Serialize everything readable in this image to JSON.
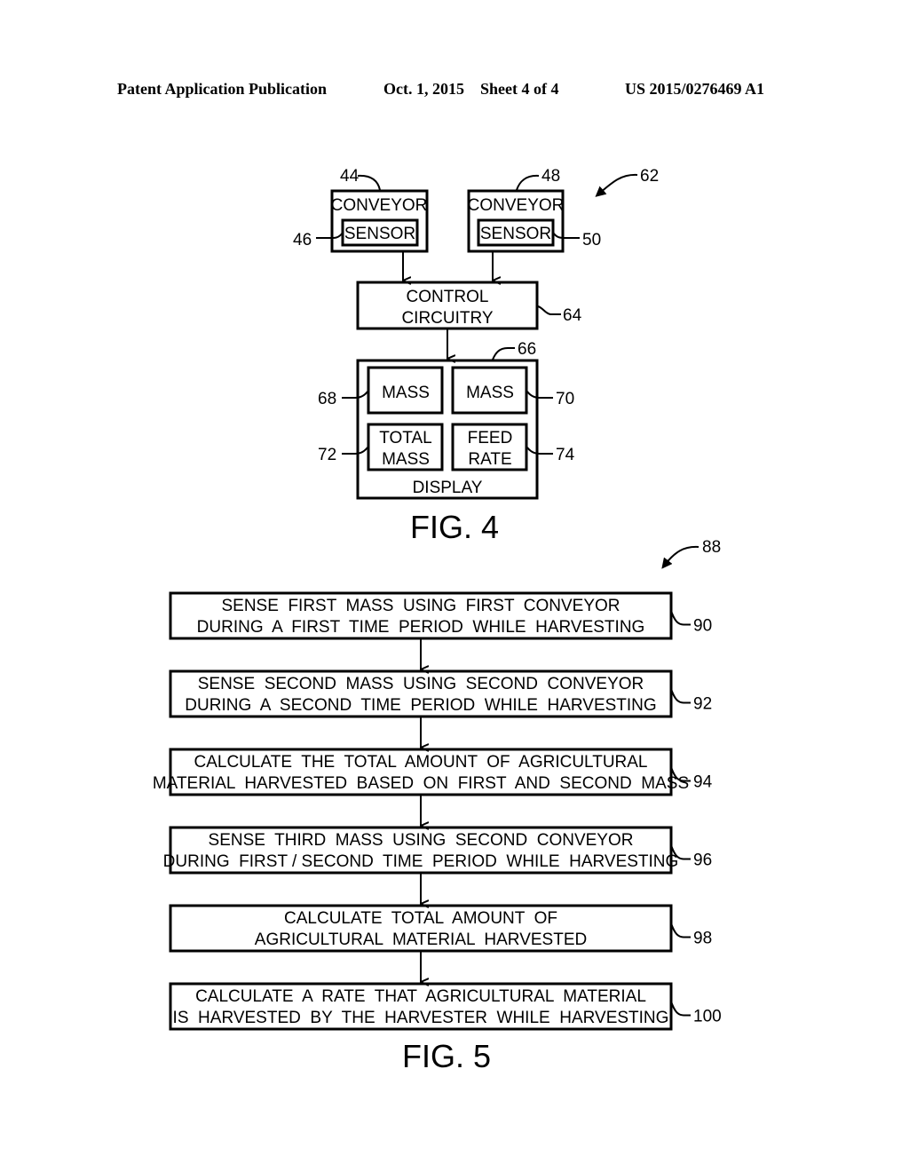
{
  "header": {
    "publication": "Patent Application Publication",
    "date_sheet": "Oct. 1, 2015    Sheet 4 of 4",
    "number": "US 2015/0276469 A1"
  },
  "fig4": {
    "caption": "FIG. 4",
    "ref_overall": "62",
    "conveyor1": {
      "label": "CONVEYOR",
      "ref": "44",
      "sensor_label": "SENSOR",
      "sensor_ref": "46"
    },
    "conveyor2": {
      "label": "CONVEYOR",
      "ref": "48",
      "sensor_label": "SENSOR",
      "sensor_ref": "50"
    },
    "control": {
      "line1": "CONTROL",
      "line2": "CIRCUITRY",
      "ref": "64"
    },
    "display": {
      "label": "DISPLAY",
      "ref": "66",
      "mass1": {
        "label": "MASS",
        "ref": "68"
      },
      "mass2": {
        "label": "MASS",
        "ref": "70"
      },
      "total_mass": {
        "line1": "TOTAL",
        "line2": "MASS",
        "ref": "72"
      },
      "feed_rate": {
        "line1": "FEED",
        "line2": "RATE",
        "ref": "74"
      }
    }
  },
  "fig5": {
    "caption": "FIG. 5",
    "ref_overall": "88",
    "steps": [
      {
        "line1": "SENSE  FIRST  MASS  USING  FIRST  CONVEYOR",
        "line2": "DURING  A  FIRST  TIME  PERIOD  WHILE  HARVESTING",
        "ref": "90"
      },
      {
        "line1": "SENSE  SECOND  MASS  USING  SECOND  CONVEYOR",
        "line2": "DURING  A  SECOND  TIME  PERIOD  WHILE  HARVESTING",
        "ref": "92"
      },
      {
        "line1": "CALCULATE  THE  TOTAL  AMOUNT  OF  AGRICULTURAL",
        "line2": "MATERIAL  HARVESTED  BASED  ON  FIRST  AND  SECOND  MASS",
        "ref": "94"
      },
      {
        "line1": "SENSE  THIRD  MASS  USING  SECOND  CONVEYOR",
        "line2": "DURING  FIRST / SECOND  TIME  PERIOD  WHILE  HARVESTING",
        "ref": "96"
      },
      {
        "line1": "CALCULATE  TOTAL  AMOUNT  OF",
        "line2": "AGRICULTURAL  MATERIAL  HARVESTED",
        "ref": "98"
      },
      {
        "line1": "CALCULATE  A  RATE  THAT  AGRICULTURAL  MATERIAL",
        "line2": "IS  HARVESTED  BY  THE  HARVESTER  WHILE  HARVESTING",
        "ref": "100"
      }
    ]
  }
}
